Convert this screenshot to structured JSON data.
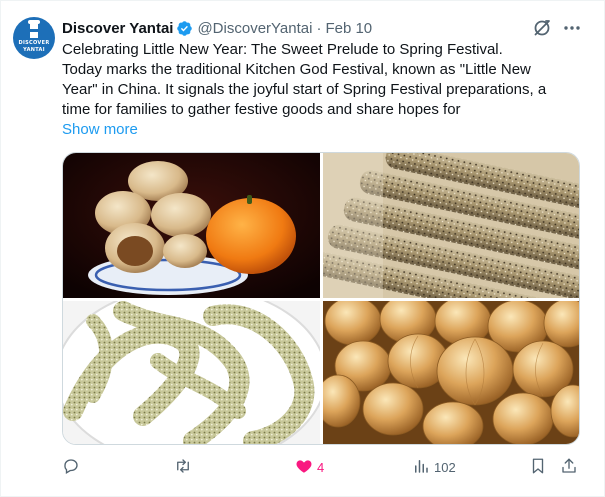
{
  "account": {
    "display_name": "Discover Yantai",
    "handle": "@DiscoverYantai",
    "separator": "·",
    "date": "Feb 10",
    "avatar_text_line1": "DISCOVER",
    "avatar_text_line2": "YANTAI",
    "verified_icon": "verified-badge-icon"
  },
  "tweet": {
    "line1": "Celebrating Little New Year: The Sweet Prelude to Spring Festival.",
    "line2": "Today marks the traditional Kitchen God Festival, known as \"Little New",
    "line3": "Year\" in China. It signals the joyful start of Spring Festival preparations, a",
    "line4": "time for families to gather festive goods and share hopes for",
    "show_more": "Show more"
  },
  "media": {
    "images": [
      {
        "name": "melon-candies-and-persimmon"
      },
      {
        "name": "sesame-candy-sticks"
      },
      {
        "name": "sesame-twist-candies"
      },
      {
        "name": "golden-melon-candies"
      }
    ]
  },
  "actions": {
    "reply_count": "",
    "retweet_count": "",
    "like_count": "4",
    "views_count": "102"
  },
  "colors": {
    "accent": "#1d9bf0",
    "like": "#f91880",
    "muted": "#536471",
    "text": "#0f1419"
  }
}
